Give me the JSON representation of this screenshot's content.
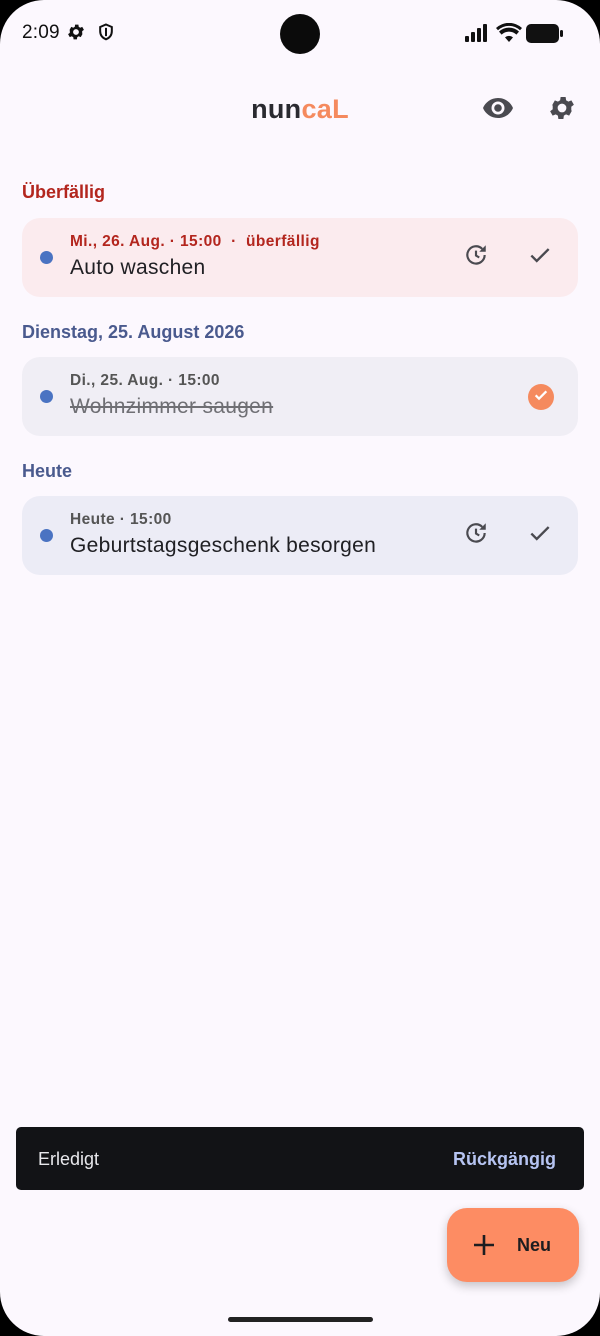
{
  "status_bar": {
    "time": "2:09",
    "icons": [
      "gear-icon",
      "shield-icon",
      "cell-signal-icon",
      "wifi-icon",
      "battery-icon"
    ]
  },
  "app_bar": {
    "title_part1": "nun",
    "title_part2": "caL",
    "accent": "#f58a5e",
    "actions": [
      "eye-icon",
      "settings-gear-icon"
    ]
  },
  "sections": [
    {
      "header": "Überfällig",
      "color": "#b3261e",
      "items": [
        {
          "meta": "Mi., 26. Aug. · 15:00  ·  überfällig",
          "title": "Auto waschen",
          "state": "overdue"
        }
      ]
    },
    {
      "header": "Dienstag, 25. August 2026",
      "color": "#4a5a8e",
      "items": [
        {
          "meta": "Di., 25. Aug. · 15:00",
          "title": "Wohnzimmer saugen",
          "state": "done"
        }
      ]
    },
    {
      "header": "Heute",
      "color": "#4a5a8e",
      "items": [
        {
          "meta": "Heute · 15:00",
          "title": "Geburtstagsgeschenk besorgen",
          "state": "open"
        }
      ]
    }
  ],
  "snackbar": {
    "message": "Erledigt",
    "action": "Rückgängig"
  },
  "fab": {
    "label": "Neu",
    "icon": "plus-icon",
    "color": "#fd8c63"
  }
}
